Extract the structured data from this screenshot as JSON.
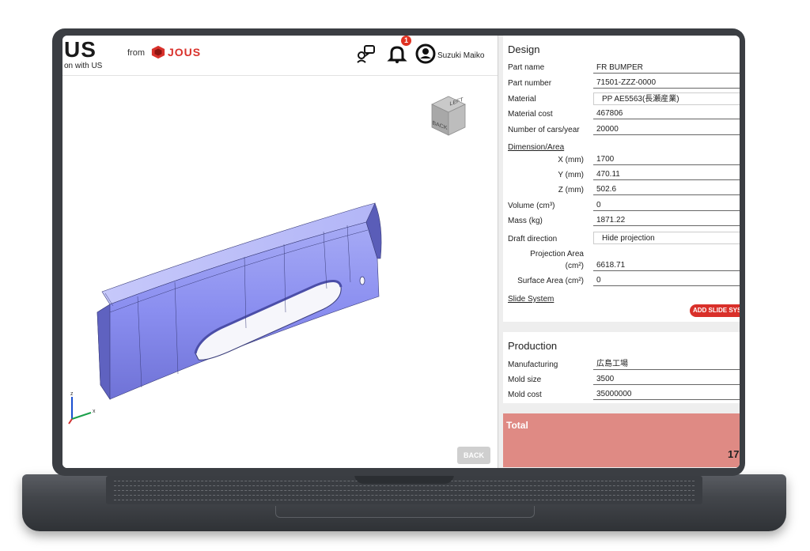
{
  "header": {
    "logo_text": "US",
    "tagline": "on with US",
    "from_label": "from",
    "brand_name": "JOUS",
    "brand_color": "#d9312b",
    "notification_count": "1",
    "user_name": "Suzuki Maiko"
  },
  "viewer": {
    "cube_faces": [
      "BACK",
      "LEFT"
    ],
    "axis_labels": [
      "z",
      "x"
    ],
    "back_button": "BACK"
  },
  "design": {
    "title": "Design",
    "part_name_label": "Part name",
    "part_name": "FR BUMPER",
    "part_number_label": "Part number",
    "part_number": "71501-ZZZ-0000",
    "material_label": "Material",
    "material": "PP AE5563(長瀬産業)",
    "material_cost_label": "Material cost",
    "material_cost": "467806",
    "cars_label": "Number of cars/year",
    "cars": "20000",
    "dimension_link": "Dimension/Area",
    "x_label": "X (mm)",
    "x": "1700",
    "y_label": "Y (mm)",
    "y": "470.11",
    "z_label": "Z (mm)",
    "z": "502.6",
    "volume_label": "Volume (cm³)",
    "volume": "0",
    "mass_label": "Mass (kg)",
    "mass": "1871.22",
    "draft_label": "Draft direction",
    "draft": "Hide projection",
    "projection_label_1": "Projection Area",
    "projection_label_2": "(cm²)",
    "projection": "6618.71",
    "surface_label": "Surface Area (cm²)",
    "surface": "0",
    "slide_link": "Slide System",
    "add_slide": "ADD SLIDE SYS"
  },
  "production": {
    "title": "Production",
    "manufacturing_label": "Manufacturing",
    "manufacturing": "広島工場",
    "mold_size_label": "Mold size",
    "mold_size": "3500",
    "mold_cost_label": "Mold cost",
    "mold_cost": "35000000"
  },
  "total": {
    "title": "Total",
    "value": "17",
    "color": "#df8a84"
  }
}
